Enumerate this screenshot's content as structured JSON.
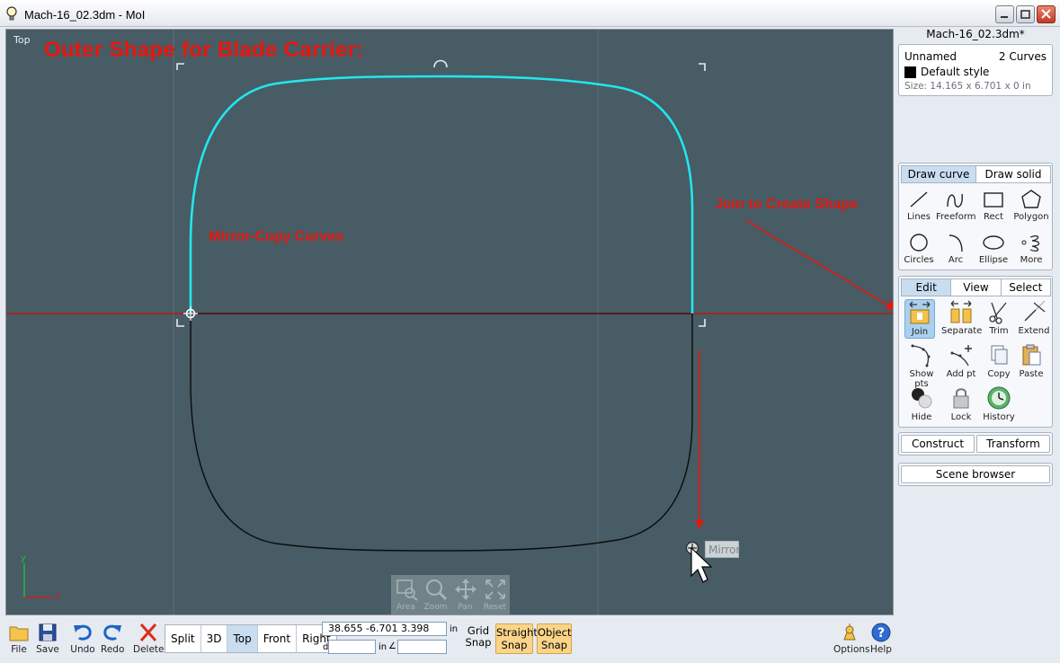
{
  "window": {
    "title": "Mach-16_02.3dm - MoI"
  },
  "viewport": {
    "view_name": "Top",
    "headline": "Outer Shape for Blade Carrier:",
    "annotation_mirror": "Mirror-Copy Curves",
    "annotation_join": "Join to Create Shape",
    "cursor_tooltip": "Mirror",
    "axis_y": "y",
    "axis_x": "x",
    "nav": [
      {
        "label": "Area",
        "icon": "zoom-area-icon"
      },
      {
        "label": "Zoom",
        "icon": "zoom-icon"
      },
      {
        "label": "Pan",
        "icon": "pan-icon"
      },
      {
        "label": "Reset",
        "icon": "reset-view-icon"
      }
    ]
  },
  "colors": {
    "viewport_bg": "#475c64",
    "selected_curve": "#22e6ee",
    "annotation_red": "#e8160f",
    "mirror_axis": "#e8160f"
  },
  "panel": {
    "doc_title": "Mach-16_02.3dm*",
    "props": {
      "name": "Unnamed",
      "count": "2 Curves",
      "style": "Default style",
      "size": "Size: 14.165 x 6.701 x 0 in"
    },
    "draw_tabs": [
      "Draw curve",
      "Draw solid"
    ],
    "draw_tools": [
      {
        "label": "Lines",
        "icon": "lines-icon"
      },
      {
        "label": "Freeform",
        "icon": "freeform-icon"
      },
      {
        "label": "Rect",
        "icon": "rect-icon"
      },
      {
        "label": "Polygon",
        "icon": "polygon-icon"
      },
      {
        "label": "Circles",
        "icon": "circle-icon"
      },
      {
        "label": "Arc",
        "icon": "arc-icon"
      },
      {
        "label": "Ellipse",
        "icon": "ellipse-icon"
      },
      {
        "label": "More",
        "icon": "more-icon"
      }
    ],
    "edit_tabs": [
      "Edit",
      "View",
      "Select"
    ],
    "edit_tools": [
      {
        "label": "Join",
        "icon": "join-icon"
      },
      {
        "label": "Separate",
        "icon": "separate-icon"
      },
      {
        "label": "Trim",
        "icon": "trim-icon"
      },
      {
        "label": "Extend",
        "icon": "extend-icon"
      },
      {
        "label": "Show pts",
        "icon": "show-points-icon"
      },
      {
        "label": "Add pt",
        "icon": "add-point-icon"
      },
      {
        "label": "Copy",
        "icon": "copy-icon"
      },
      {
        "label": "Paste",
        "icon": "paste-icon"
      },
      {
        "label": "Hide",
        "icon": "hide-icon"
      },
      {
        "label": "Lock",
        "icon": "lock-icon"
      },
      {
        "label": "History",
        "icon": "history-icon"
      }
    ],
    "construct": "Construct",
    "transform": "Transform",
    "scene_browser": "Scene browser"
  },
  "toolbar": {
    "file": "File",
    "save": "Save",
    "undo": "Undo",
    "redo": "Redo",
    "delete": "Delete",
    "views": [
      "Split",
      "3D",
      "Top",
      "Front",
      "Right"
    ],
    "active_view": "Top",
    "coords": "38.655    -6.701  3.398",
    "coords_unit": "in",
    "distance_label": "d",
    "distance_unit": "in",
    "angle_label": "∠",
    "grid_snap": "Grid\nSnap",
    "straight_snap": "Straight\nSnap",
    "object_snap": "Object\nSnap",
    "options": "Options",
    "help": "Help"
  }
}
